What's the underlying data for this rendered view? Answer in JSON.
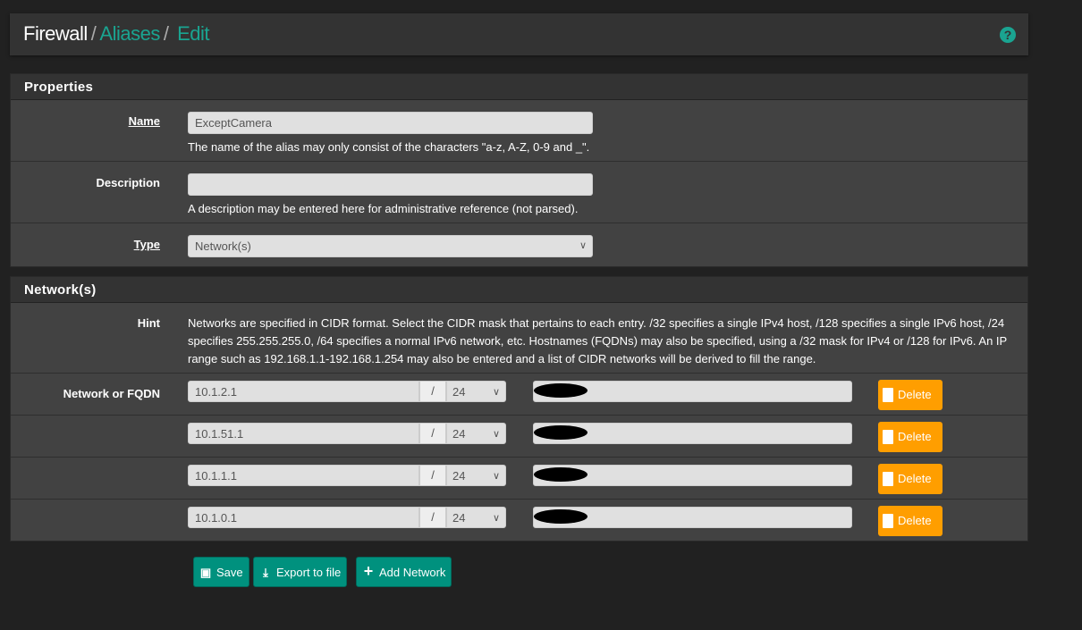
{
  "breadcrumb": {
    "root": "Firewall",
    "sep": "/",
    "aliases": "Aliases",
    "edit": "Edit"
  },
  "help_icon": "?",
  "properties": {
    "title": "Properties",
    "name": {
      "label": "Name",
      "value": "ExceptCamera",
      "help": "The name of the alias may only consist of the characters \"a-z, A-Z, 0-9 and _\"."
    },
    "description": {
      "label": "Description",
      "value": "",
      "help": "A description may be entered here for administrative reference (not parsed)."
    },
    "type": {
      "label": "Type",
      "value": "Network(s)"
    }
  },
  "networks": {
    "title": "Network(s)",
    "hint_label": "Hint",
    "hint": "Networks are specified in CIDR format. Select the CIDR mask that pertains to each entry. /32 specifies a single IPv4 host, /128 specifies a single IPv6 host, /24 specifies 255.255.255.0, /64 specifies a normal IPv6 network, etc. Hostnames (FQDNs) may also be specified, using a /32 mask for IPv4 or /128 for IPv6. An IP range such as 192.168.1.1-192.168.1.254 may also be entered and a list of CIDR networks will be derived to fill the range.",
    "row_label": "Network or FQDN",
    "slash": "/",
    "delete_label": "Delete",
    "rows": [
      {
        "address": "10.1.2.1",
        "mask": "24"
      },
      {
        "address": "10.1.51.1",
        "mask": "24"
      },
      {
        "address": "10.1.1.1",
        "mask": "24"
      },
      {
        "address": "10.1.0.1",
        "mask": "24"
      }
    ]
  },
  "actions": {
    "save": "Save",
    "export": "Export to file",
    "add": "Add Network"
  },
  "colors": {
    "accent": "#1aa491",
    "button": "#00917e",
    "delete": "#ff9e00"
  }
}
